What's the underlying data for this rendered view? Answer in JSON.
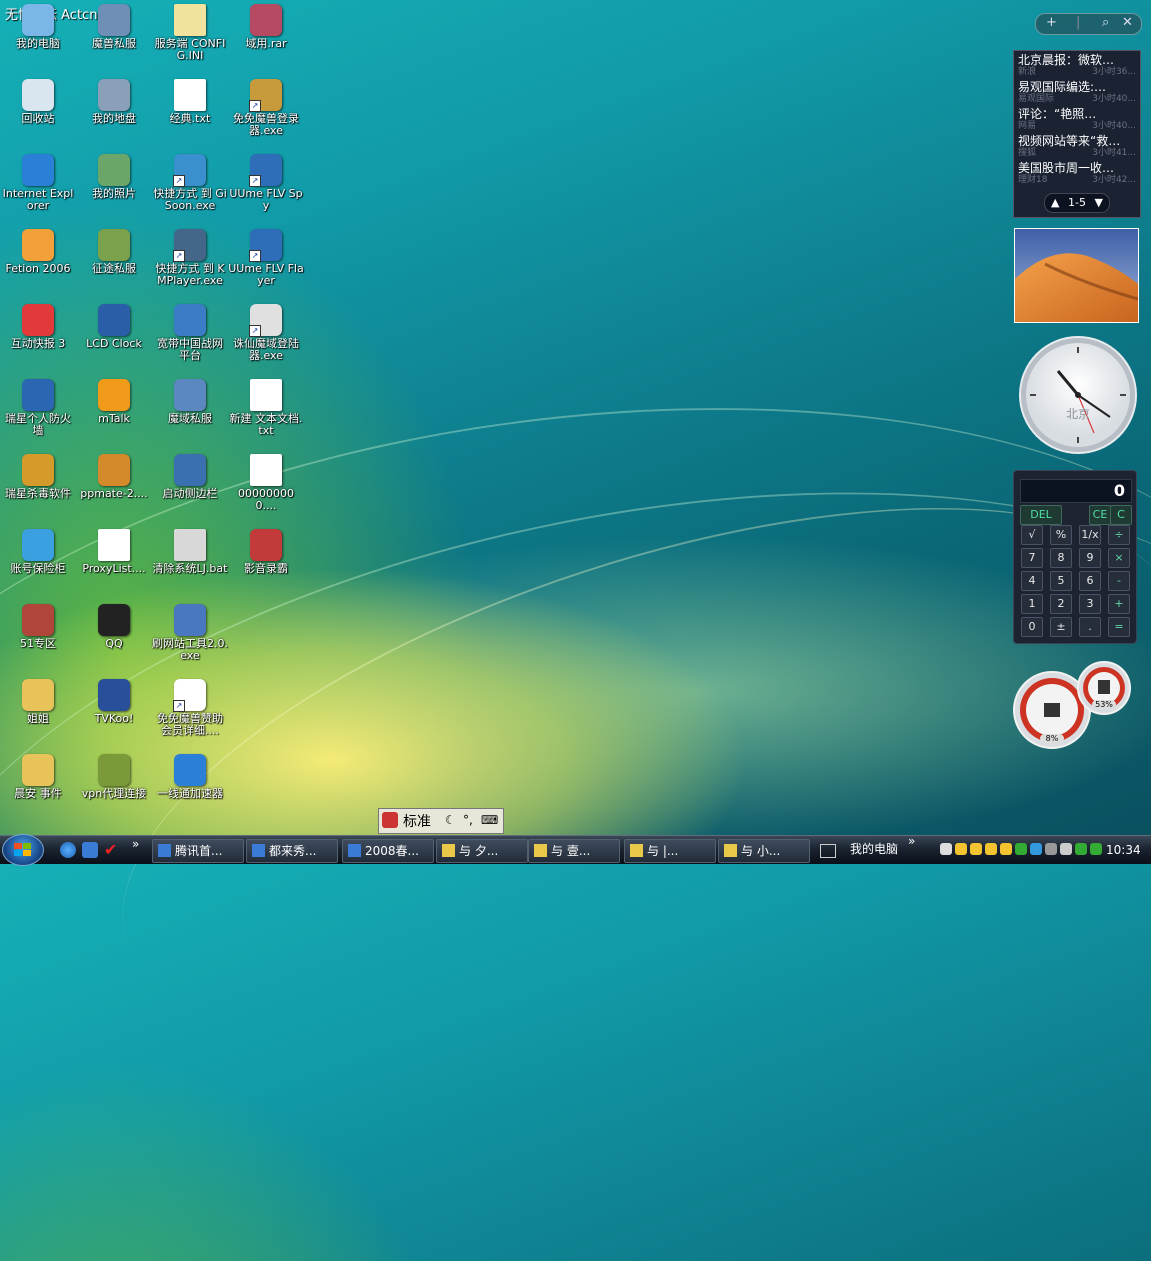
{
  "watermark": "无忧论坛 Actcn.net",
  "desktop_icons": [
    {
      "label": "我的电脑",
      "icon": "computer-icon",
      "color": "#7ab6e8"
    },
    {
      "label": "魔兽私服",
      "icon": "program-icon",
      "color": "#6f8fb6"
    },
    {
      "label": "服务端 CONFIG.INI",
      "icon": "ini-file-icon",
      "color": "#f1e39d"
    },
    {
      "label": "域用.rar",
      "icon": "winrar-icon",
      "color": "#b74a63"
    },
    {
      "label": "回收站",
      "icon": "recycle-bin-icon",
      "color": "#d9e6ef"
    },
    {
      "label": "我的地盘",
      "icon": "program-icon",
      "color": "#8aa0b8"
    },
    {
      "label": "经典.txt",
      "icon": "text-file-icon",
      "color": "#ffffff"
    },
    {
      "label": "免免魔兽登录器.exe",
      "icon": "game-icon",
      "color": "#c79a3b"
    },
    {
      "label": "Internet Explorer",
      "icon": "ie-icon",
      "color": "#2a7fd6"
    },
    {
      "label": "我的照片",
      "icon": "program-icon",
      "color": "#6aa66a"
    },
    {
      "label": "快捷方式 到 GiSoon.exe",
      "icon": "shortcut-icon",
      "color": "#3a8fcf"
    },
    {
      "label": "UUme FLV Spy",
      "icon": "flv-icon",
      "color": "#2e6db8"
    },
    {
      "label": "Fetion 2006",
      "icon": "fetion-icon",
      "color": "#f2a03a"
    },
    {
      "label": "征途私服",
      "icon": "program-icon",
      "color": "#7aa14b"
    },
    {
      "label": "快捷方式 到 KMPlayer.exe",
      "icon": "kmplayer-icon",
      "color": "#446688"
    },
    {
      "label": "UUme FLV Flayer",
      "icon": "flv-icon",
      "color": "#2e6db8"
    },
    {
      "label": "互动快报 3",
      "icon": "news-icon",
      "color": "#e23a3a"
    },
    {
      "label": "LCD Clock",
      "icon": "clock-icon",
      "color": "#2a5ea8"
    },
    {
      "label": "宽带中国战网平台",
      "icon": "network-icon",
      "color": "#3a7cc5"
    },
    {
      "label": "诛仙魔域登陆器.exe",
      "icon": "game-icon",
      "color": "#e0e0e0"
    },
    {
      "label": "瑞星个人防火墙",
      "icon": "firewall-icon",
      "color": "#2b66b3"
    },
    {
      "label": "mTalk",
      "icon": "mtalk-icon",
      "color": "#f09a1a"
    },
    {
      "label": "魔域私服",
      "icon": "program-icon",
      "color": "#5c88c2"
    },
    {
      "label": "新建 文本文档.txt",
      "icon": "text-file-icon",
      "color": "#ffffff"
    },
    {
      "label": "瑞星杀毒软件",
      "icon": "antivirus-icon",
      "color": "#d59b2a"
    },
    {
      "label": "ppmate-2....",
      "icon": "installer-icon",
      "color": "#d48a2a"
    },
    {
      "label": "启动侧边栏",
      "icon": "sidebar-icon",
      "color": "#3a6fb0"
    },
    {
      "label": "000000000....",
      "icon": "text-file-icon",
      "color": "#ffffff"
    },
    {
      "label": "账号保险柜",
      "icon": "safe-icon",
      "color": "#3aa0e0"
    },
    {
      "label": "ProxyList....",
      "icon": "text-file-icon",
      "color": "#ffffff"
    },
    {
      "label": "清除系统LJ.bat",
      "icon": "bat-file-icon",
      "color": "#d8d8d8"
    },
    {
      "label": "影音录霸",
      "icon": "recorder-icon",
      "color": "#c23a3a"
    },
    {
      "label": "51专区",
      "icon": "program-icon",
      "color": "#b0463a"
    },
    {
      "label": "QQ",
      "icon": "qq-icon",
      "color": "#222222"
    },
    {
      "label": "刷网站工具2.0.exe",
      "icon": "program-icon",
      "color": "#4a78c0"
    },
    {
      "label": "",
      "icon": "none",
      "color": ""
    },
    {
      "label": "姐姐",
      "icon": "folder-icon",
      "color": "#e8c35a"
    },
    {
      "label": "TVKoo!",
      "icon": "tv-icon",
      "color": "#2a4f9a"
    },
    {
      "label": "免免魔兽赞助会员详细....",
      "icon": "shortcut-icon",
      "color": "#ffffff"
    },
    {
      "label": "",
      "icon": "none",
      "color": ""
    },
    {
      "label": "晨安 事件",
      "icon": "folder-icon",
      "color": "#e8c35a"
    },
    {
      "label": "vpn代理连接",
      "icon": "vpn-icon",
      "color": "#7a9a3a"
    },
    {
      "label": "一线通加速器",
      "icon": "accelerator-icon",
      "color": "#2a7fd6"
    }
  ],
  "sidebar": {
    "news": {
      "items": [
        {
          "title": "北京晨报：微软…",
          "source": "新浪",
          "time": "3小时36..."
        },
        {
          "title": "易观国际编选:…",
          "source": "易观国际",
          "time": "3小时40..."
        },
        {
          "title": "评论：“艳照…",
          "source": "网易",
          "time": "3小时40..."
        },
        {
          "title": "视频网站等来“救…",
          "source": "搜狐",
          "time": "3小时41..."
        },
        {
          "title": "美国股市周一收…",
          "source": "理财18",
          "time": "3小时42..."
        }
      ],
      "pager": "1-5"
    },
    "clock_label": "北京",
    "calculator": {
      "display": "0",
      "keys": [
        "DEL",
        "CE",
        "C",
        "√",
        "%",
        "1/x",
        "÷",
        "7",
        "8",
        "9",
        "×",
        "4",
        "5",
        "6",
        "-",
        "1",
        "2",
        "3",
        "+",
        "0",
        "±",
        ".",
        "="
      ]
    },
    "meter": {
      "cpu": "8%",
      "memory": "53%"
    }
  },
  "ime": {
    "mode": "标准"
  },
  "taskbar": {
    "tasks": [
      {
        "label": "腾讯首..."
      },
      {
        "label": "都来秀..."
      },
      {
        "label": "2008春..."
      },
      {
        "label": "与 夕..."
      },
      {
        "label": "与 壹..."
      },
      {
        "label": "与 |..."
      },
      {
        "label": "与 小..."
      }
    ],
    "address_label": "我的电脑",
    "time": "10:34"
  }
}
